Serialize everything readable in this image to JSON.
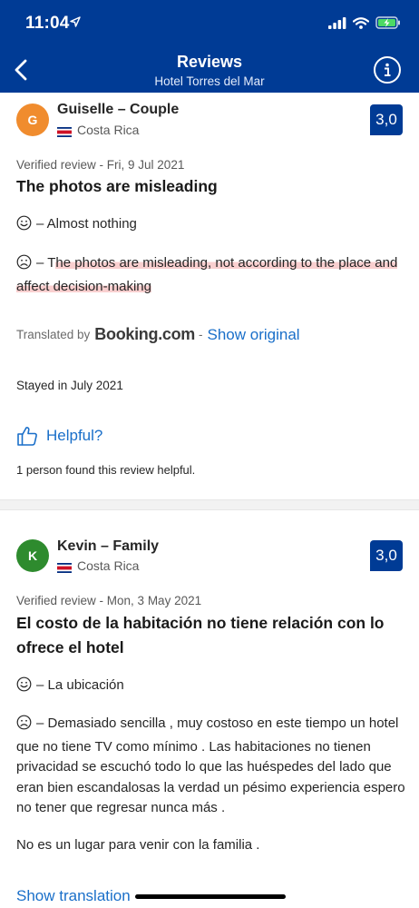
{
  "status_bar": {
    "time": "11:04"
  },
  "nav": {
    "title": "Reviews",
    "subtitle": "Hotel Torres del Mar"
  },
  "reviews": [
    {
      "initial": "G",
      "avatar_color": "#f08c2e",
      "name": "Guiselle – Couple",
      "country": "Costa Rica",
      "score": "3,0",
      "verified_label": "Verified review",
      "date": " - Fri, 9 Jul 2021",
      "title": "The photos are misleading",
      "positive": "– Almost nothing",
      "negative_pre": "– T",
      "negative_hl": "he photos are misleading, not according to the place and affect decision-making",
      "translated_by": "Translated by",
      "brand": "Booking.com",
      "brand_sep": "-",
      "show_original": "Show original",
      "stayed": "Stayed in July 2021",
      "helpful": "Helpful?",
      "helpful_count": "1 person found this review helpful."
    },
    {
      "initial": "K",
      "avatar_color": "#2e8b2e",
      "name": "Kevin – Family",
      "country": "Costa Rica",
      "score": "3,0",
      "verified_label": "Verified review",
      "date": " - Mon, 3 May 2021",
      "title": "El costo de la habitación no tiene relación con lo ofrece el hotel",
      "positive": "– La ubicación",
      "negative": "– Demasiado sencilla , muy costoso en este tiempo un hotel que no tiene TV como mínimo . Las habitaciones no tienen privacidad se escuchó todo lo que las huéspedes del lado que eran bien escandalosas la verdad un pésimo experiencia espero no tener que regresar nunca más .",
      "extra": "No es un lugar para venir con la familia .",
      "show_translation": "Show translation"
    }
  ],
  "icons": {
    "positive": "smiley-face-icon",
    "negative": "frown-face-icon",
    "helpful": "thumbs-up-icon",
    "back": "back-arrow-icon",
    "info": "info-icon"
  },
  "colors": {
    "brand_blue": "#003b95",
    "link_blue": "#1a6fc9",
    "highlight": "#f9cfcf"
  }
}
